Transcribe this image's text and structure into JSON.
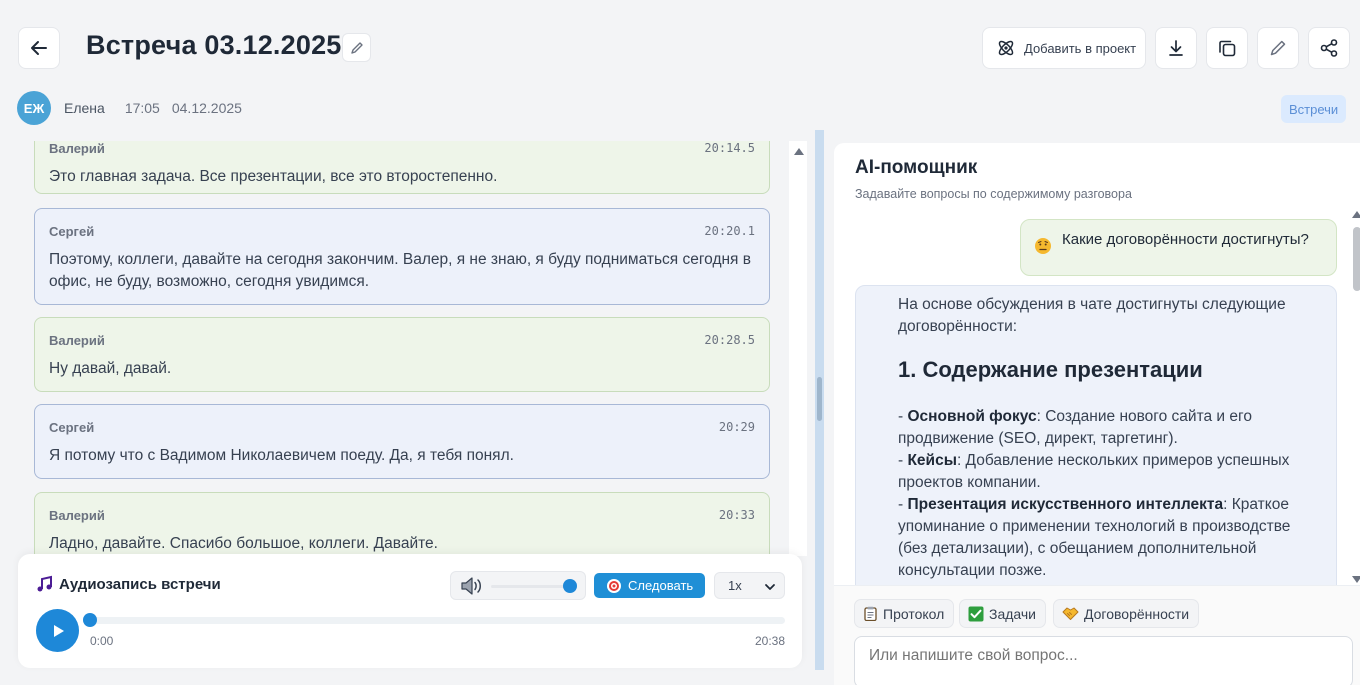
{
  "header": {
    "title": "Встреча 03.12.2025",
    "add_to_project_label": "Добавить в проект",
    "author_initials": "ЕЖ",
    "author_name": "Елена",
    "time": "17:05",
    "date": "04.12.2025",
    "tag": "Встречи",
    "icons": [
      "arrow-left-icon",
      "pencil-icon",
      "atom-icon",
      "download-icon",
      "copy-icon",
      "edit-icon",
      "share-icon"
    ]
  },
  "transcript": {
    "messages": [
      {
        "speaker": "Валерий",
        "time": "20:14.5",
        "text": "Это главная задача. Все презентации, все это второстепенно."
      },
      {
        "speaker": "Сергей",
        "time": "20:20.1",
        "text": "Поэтому, коллеги, давайте на сегодня закончим. Валер, я не знаю, я буду подниматься сегодня в офис, не буду, возможно, сегодня увидимся."
      },
      {
        "speaker": "Валерий",
        "time": "20:28.5",
        "text": "Ну давай, давай."
      },
      {
        "speaker": "Сергей",
        "time": "20:29",
        "text": "Я потому что с Вадимом Николаевичем поеду. Да, я тебя понял."
      },
      {
        "speaker": "Валерий",
        "time": "20:33",
        "text": "Ладно, давайте. Спасибо большое, коллеги. Давайте."
      }
    ]
  },
  "audio": {
    "title": "Аудиозапись встречи",
    "follow_label": "Следовать",
    "speed": "1x",
    "current_time": "0:00",
    "total_time": "20:38",
    "volume_fraction": 0.9,
    "progress_fraction": 0.0
  },
  "ai": {
    "title": "AI-помощник",
    "subtitle": "Задавайте вопросы по содержимому разговора",
    "user_question": "Какие договорённости достигнуты?",
    "answer_intro": "На основе обсуждения в чате достигнуты следующие договорённости:",
    "answer_heading": "1. Содержание презентации",
    "answer_items": [
      {
        "label": "Основной фокус",
        "text": ": Создание нового сайта и его продвижение (SEO, директ, таргетинг)."
      },
      {
        "label": "Кейсы",
        "text": ": Добавление нескольких примеров успешных проектов компании."
      },
      {
        "label": "Презентация искусственного интеллекта",
        "text": ": Краткое упоминание о применении технологий в производстве (без детализации), с обещанием дополнительной консультации позже."
      }
    ],
    "quick_actions": [
      {
        "label": "Протокол",
        "icon": "clipboard-icon"
      },
      {
        "label": "Задачи",
        "icon": "checkbox-icon"
      },
      {
        "label": "Договорённости",
        "icon": "handshake-icon"
      }
    ],
    "input_placeholder": "Или напишите свой вопрос..."
  },
  "colors": {
    "accent": "#1e88d8",
    "valeriy_bg": "#eef5e9",
    "sergey_bg": "#edf1fa"
  }
}
